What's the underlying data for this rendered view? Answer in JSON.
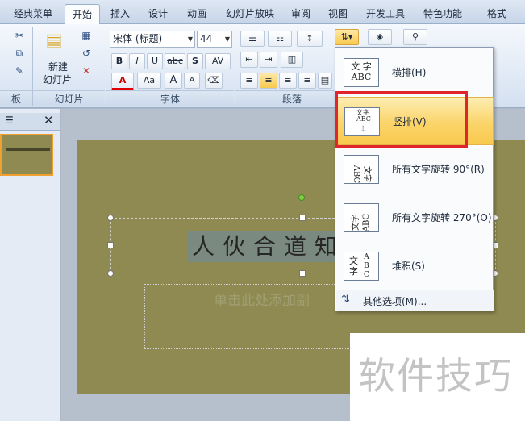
{
  "tabs": [
    "经典菜单",
    "开始",
    "插入",
    "设计",
    "动画",
    "幻灯片放映",
    "审阅",
    "视图",
    "开发工具",
    "特色功能",
    "格式"
  ],
  "active_tab": "开始",
  "ribbon": {
    "groups": {
      "clipboard": "板",
      "slides": "幻灯片",
      "font": "字体",
      "paragraph": "段落"
    },
    "new_slide_line1": "新建",
    "new_slide_line2": "幻灯片",
    "font_name": "宋体 (标题)",
    "font_size": "44",
    "bold": "B",
    "italic": "I",
    "underline": "U",
    "strike": "abc",
    "shadow": "S",
    "spacing": "AV",
    "color": "A",
    "case": "Aa",
    "grow": "A",
    "shrink": "A"
  },
  "slide": {
    "title": "人伙合道知",
    "subtitle": "单击此处添加副"
  },
  "menu": {
    "items": [
      {
        "label": "横排(H)",
        "icon_text": "文字ABC",
        "icon": "horizontal-text-icon"
      },
      {
        "label": "竖排(V)",
        "icon_text": "竖排",
        "icon": "vertical-text-icon"
      },
      {
        "label": "所有文字旋转 90°(R)",
        "icon_text": "文字ABC",
        "icon": "rotate-90-icon"
      },
      {
        "label": "所有文字旋转 270°(O)",
        "icon_text": "文字ABC",
        "icon": "rotate-270-icon"
      },
      {
        "label": "堆积(S)",
        "icon_text": "文字ABC",
        "icon": "stacked-text-icon"
      }
    ],
    "footer": "其他选项(M)..."
  },
  "watermark": "软件技巧",
  "colors": {
    "highlight": "#fbd46a",
    "redbox": "#e0262a",
    "slide_bg": "#8f8a52"
  }
}
